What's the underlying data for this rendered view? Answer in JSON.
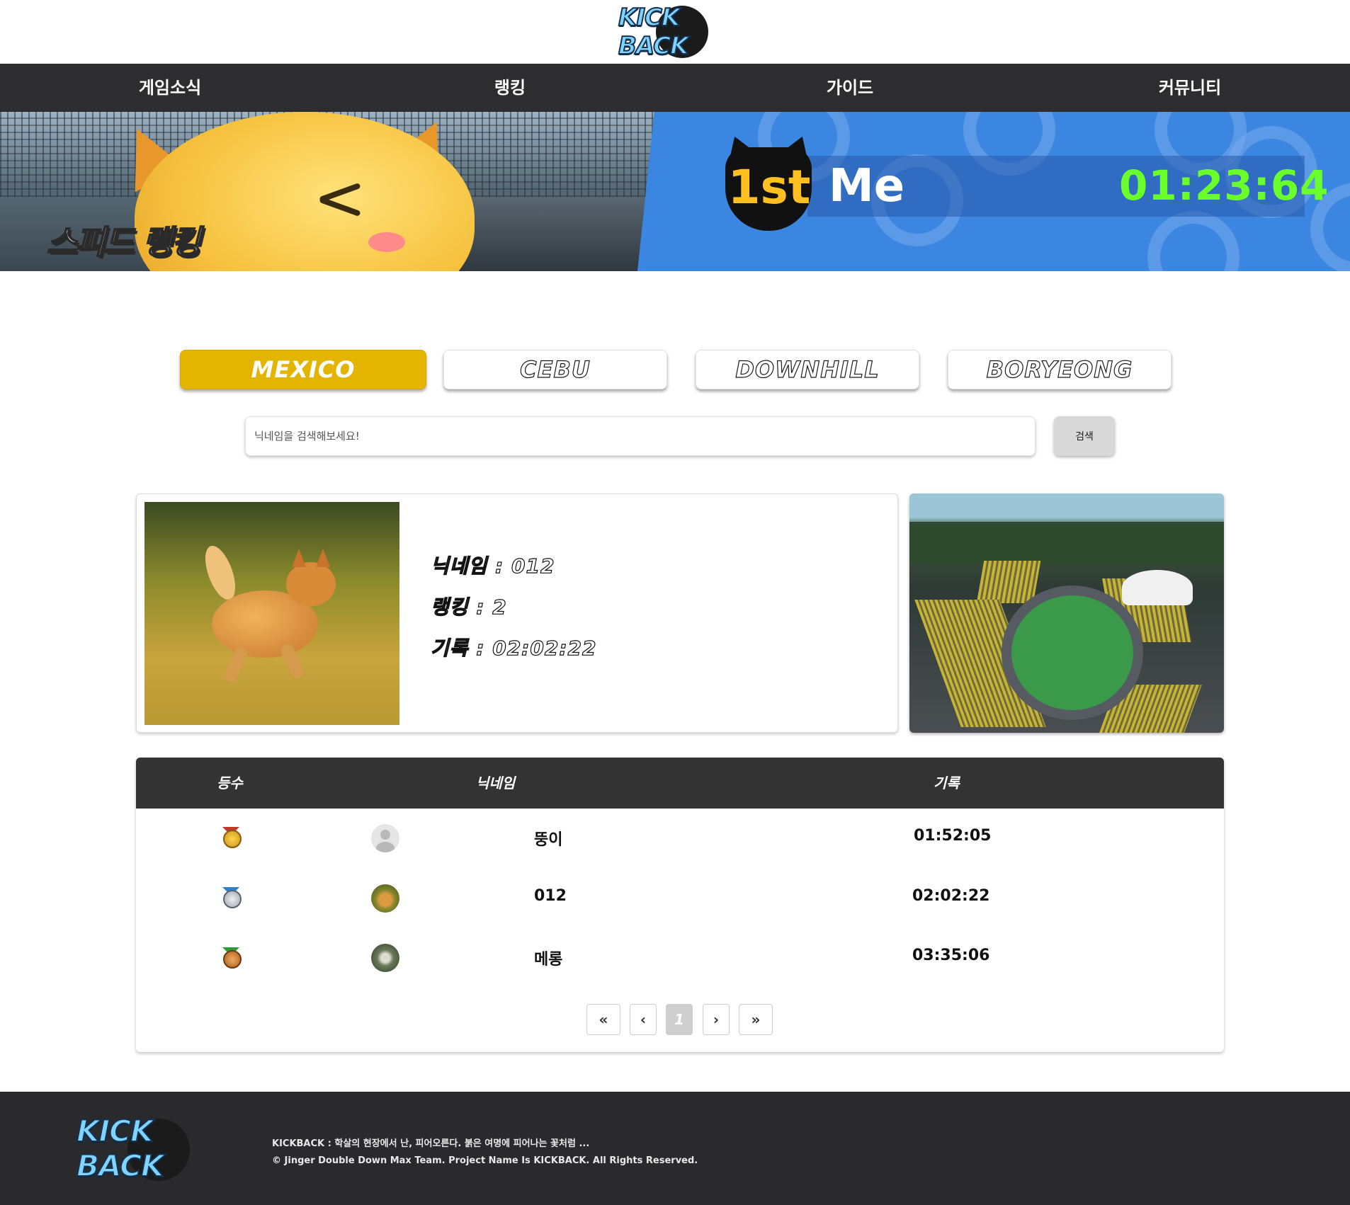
{
  "header": {
    "logo_text": "KICK BACK"
  },
  "nav": {
    "items": [
      "게임소식",
      "랭킹",
      "가이드",
      "커뮤니티"
    ]
  },
  "banner": {
    "title": "스피드 랭킹",
    "rank": "1st",
    "name": "Me",
    "time": "01:23:64"
  },
  "tabs": {
    "items": [
      "MEXICO",
      "CEBU",
      "DOWNHILL",
      "BORYEONG"
    ],
    "active": "MEXICO"
  },
  "search": {
    "placeholder": "닉네임을 검색해보세요!",
    "button": "검색"
  },
  "profile": {
    "nickname_line": "닉네임 : 012",
    "ranking_line": "랭킹 : 2",
    "record_line": "기록 : 02:02:22"
  },
  "table": {
    "headers": [
      "등수",
      "닉네임",
      "기록"
    ],
    "rows": [
      {
        "medal": "gold-medal-icon",
        "nickname": "뚱이",
        "record": "01:52:05"
      },
      {
        "medal": "silver-medal-icon",
        "nickname": "012",
        "record": "02:02:22"
      },
      {
        "medal": "bronze-medal-icon",
        "nickname": "메롱",
        "record": "03:35:06"
      }
    ]
  },
  "pagination": {
    "first": "«",
    "prev": "‹",
    "current": "1",
    "next": "›",
    "last": "»"
  },
  "footer": {
    "logo_text": "KICK BACK",
    "tagline": "KICKBACK : 학살의 현장에서 난, 피어오른다. 붉은 여명에 피어나는 꽃처럼 ...",
    "copyright": "© Jinger Double Down Max Team. Project Name Is KICKBACK. All Rights Reserved."
  },
  "colors": {
    "nav_bg": "#2d2d2f",
    "active_tab": "#e3b500",
    "banner_blue": "#3a86e0",
    "time_green": "#6aff2a",
    "footer_bg": "#2a2a2c"
  }
}
